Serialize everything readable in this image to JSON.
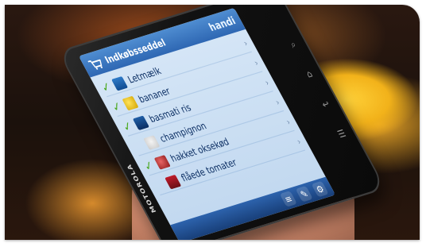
{
  "app": {
    "brand": "MOTOROLA",
    "name": "handi",
    "screen_title": "Indkøbsseddel"
  },
  "list": {
    "items": [
      {
        "name": "Letmælk",
        "checked": true,
        "chevron": "›"
      },
      {
        "name": "bananer",
        "checked": true,
        "chevron": "›"
      },
      {
        "name": "basmati ris",
        "checked": true,
        "chevron": "›"
      },
      {
        "name": "champignon",
        "checked": false,
        "chevron": "›"
      },
      {
        "name": "hakket oksekød",
        "checked": true,
        "chevron": "›"
      },
      {
        "name": "flåede tomater",
        "checked": false,
        "chevron": "›"
      }
    ]
  },
  "toolbar": {
    "buttons": [
      "list-icon",
      "note-icon",
      "settings-icon"
    ]
  },
  "phone_keys": [
    "search-icon",
    "home-icon",
    "back-icon",
    "menu-icon"
  ],
  "colors": {
    "header": "#2e67b3",
    "check": "#4aa81f",
    "screen_bg": "#c0d7ef"
  }
}
